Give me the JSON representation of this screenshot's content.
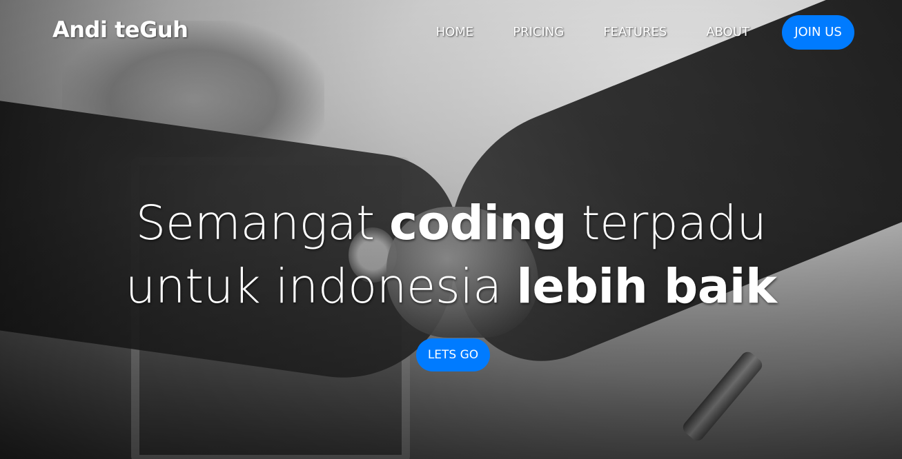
{
  "navbar": {
    "brand": "Andi teGuh",
    "links": [
      {
        "label": "HOME"
      },
      {
        "label": "PRICING"
      },
      {
        "label": "FEATURES"
      },
      {
        "label": "ABOUT"
      }
    ],
    "join_label": "JOIN US",
    "accent_color": "#007bff"
  },
  "hero": {
    "line1": {
      "part1": "Semangat ",
      "bold": "coding",
      "part2": " terpadu"
    },
    "line2": {
      "part1": "untuk indonesia ",
      "bold": "lebih baik"
    },
    "cta_label": "LETS GO"
  }
}
